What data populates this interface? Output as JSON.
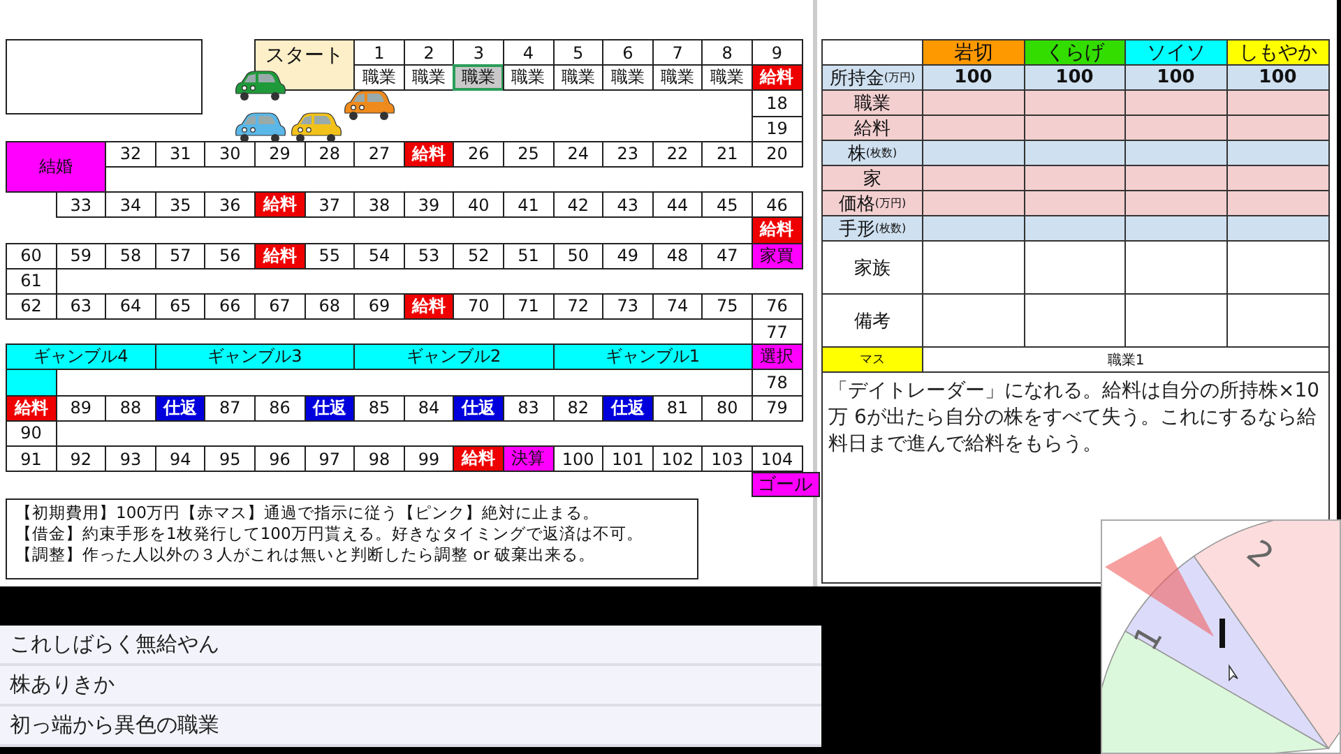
{
  "board": {
    "track": [
      {
        "squares": [
          {
            "label": "スタート",
            "kind": "start",
            "selected": false
          },
          {
            "label": "1",
            "kind": "number",
            "selected": false
          },
          {
            "label": "2",
            "kind": "number",
            "selected": false
          },
          {
            "label": "3",
            "kind": "number",
            "selected": false
          },
          {
            "label": "4",
            "kind": "number",
            "selected": false
          },
          {
            "label": "5",
            "kind": "number",
            "selected": false
          },
          {
            "label": "6",
            "kind": "number",
            "selected": false
          },
          {
            "label": "7",
            "kind": "number",
            "selected": false
          },
          {
            "label": "8",
            "kind": "number",
            "selected": false
          },
          {
            "label": "9",
            "kind": "number",
            "selected": false
          }
        ]
      },
      {
        "squares": [
          {
            "label": "職業",
            "kind": "job",
            "selected": false
          },
          {
            "label": "職業",
            "kind": "job",
            "selected": false
          },
          {
            "label": "職業",
            "kind": "job",
            "selected": true
          },
          {
            "label": "職業",
            "kind": "job",
            "selected": false
          },
          {
            "label": "職業",
            "kind": "job",
            "selected": false
          },
          {
            "label": "職業",
            "kind": "job",
            "selected": false
          },
          {
            "label": "職業",
            "kind": "job",
            "selected": false
          },
          {
            "label": "職業",
            "kind": "job",
            "selected": false
          },
          {
            "label": "給料",
            "kind": "salary",
            "selected": false
          }
        ]
      },
      {
        "squares": [
          {
            "label": "18",
            "kind": "number",
            "selected": false
          }
        ]
      },
      {
        "squares": [
          {
            "label": "19",
            "kind": "number",
            "selected": false
          }
        ]
      },
      {
        "squares": [
          {
            "label": "結婚",
            "kind": "event",
            "selected": false
          },
          {
            "label": "32",
            "kind": "number",
            "selected": false
          },
          {
            "label": "31",
            "kind": "number",
            "selected": false
          },
          {
            "label": "30",
            "kind": "number",
            "selected": false
          },
          {
            "label": "29",
            "kind": "number",
            "selected": false
          },
          {
            "label": "28",
            "kind": "number",
            "selected": false
          },
          {
            "label": "27",
            "kind": "number",
            "selected": false
          },
          {
            "label": "給料",
            "kind": "salary",
            "selected": false
          },
          {
            "label": "26",
            "kind": "number",
            "selected": false
          },
          {
            "label": "25",
            "kind": "number",
            "selected": false
          },
          {
            "label": "24",
            "kind": "number",
            "selected": false
          },
          {
            "label": "23",
            "kind": "number",
            "selected": false
          },
          {
            "label": "22",
            "kind": "number",
            "selected": false
          },
          {
            "label": "21",
            "kind": "number",
            "selected": false
          },
          {
            "label": "20",
            "kind": "number",
            "selected": false
          }
        ]
      },
      {
        "squares": [
          {
            "label": "33",
            "kind": "number",
            "selected": false
          },
          {
            "label": "34",
            "kind": "number",
            "selected": false
          },
          {
            "label": "35",
            "kind": "number",
            "selected": false
          },
          {
            "label": "36",
            "kind": "number",
            "selected": false
          },
          {
            "label": "給料",
            "kind": "salary",
            "selected": false
          },
          {
            "label": "37",
            "kind": "number",
            "selected": false
          },
          {
            "label": "38",
            "kind": "number",
            "selected": false
          },
          {
            "label": "39",
            "kind": "number",
            "selected": false
          },
          {
            "label": "40",
            "kind": "number",
            "selected": false
          },
          {
            "label": "41",
            "kind": "number",
            "selected": false
          },
          {
            "label": "42",
            "kind": "number",
            "selected": false
          },
          {
            "label": "43",
            "kind": "number",
            "selected": false
          },
          {
            "label": "44",
            "kind": "number",
            "selected": false
          },
          {
            "label": "45",
            "kind": "number",
            "selected": false
          },
          {
            "label": "46",
            "kind": "number",
            "selected": false
          }
        ]
      },
      {
        "squares": [
          {
            "label": "給料",
            "kind": "salary",
            "selected": false
          }
        ]
      },
      {
        "squares": [
          {
            "label": "60",
            "kind": "number",
            "selected": false
          },
          {
            "label": "59",
            "kind": "number",
            "selected": false
          },
          {
            "label": "58",
            "kind": "number",
            "selected": false
          },
          {
            "label": "57",
            "kind": "number",
            "selected": false
          },
          {
            "label": "56",
            "kind": "number",
            "selected": false
          },
          {
            "label": "給料",
            "kind": "salary",
            "selected": false
          },
          {
            "label": "55",
            "kind": "number",
            "selected": false
          },
          {
            "label": "54",
            "kind": "number",
            "selected": false
          },
          {
            "label": "53",
            "kind": "number",
            "selected": false
          },
          {
            "label": "52",
            "kind": "number",
            "selected": false
          },
          {
            "label": "51",
            "kind": "number",
            "selected": false
          },
          {
            "label": "50",
            "kind": "number",
            "selected": false
          },
          {
            "label": "49",
            "kind": "number",
            "selected": false
          },
          {
            "label": "48",
            "kind": "number",
            "selected": false
          },
          {
            "label": "47",
            "kind": "number",
            "selected": false
          },
          {
            "label": "家買",
            "kind": "event",
            "selected": false
          }
        ]
      },
      {
        "squares": [
          {
            "label": "61",
            "kind": "number",
            "selected": false
          }
        ]
      },
      {
        "squares": [
          {
            "label": "62",
            "kind": "number",
            "selected": false
          },
          {
            "label": "63",
            "kind": "number",
            "selected": false
          },
          {
            "label": "64",
            "kind": "number",
            "selected": false
          },
          {
            "label": "65",
            "kind": "number",
            "selected": false
          },
          {
            "label": "66",
            "kind": "number",
            "selected": false
          },
          {
            "label": "67",
            "kind": "number",
            "selected": false
          },
          {
            "label": "68",
            "kind": "number",
            "selected": false
          },
          {
            "label": "69",
            "kind": "number",
            "selected": false
          },
          {
            "label": "給料",
            "kind": "salary",
            "selected": false
          },
          {
            "label": "70",
            "kind": "number",
            "selected": false
          },
          {
            "label": "71",
            "kind": "number",
            "selected": false
          },
          {
            "label": "72",
            "kind": "number",
            "selected": false
          },
          {
            "label": "73",
            "kind": "number",
            "selected": false
          },
          {
            "label": "74",
            "kind": "number",
            "selected": false
          },
          {
            "label": "75",
            "kind": "number",
            "selected": false
          },
          {
            "label": "76",
            "kind": "number",
            "selected": false
          }
        ]
      },
      {
        "squares": [
          {
            "label": "77",
            "kind": "number",
            "selected": false
          }
        ]
      },
      {
        "squares": [
          {
            "label": "ギャンブル4",
            "kind": "gamble",
            "selected": false
          },
          {
            "label": "ギャンブル3",
            "kind": "gamble",
            "selected": false
          },
          {
            "label": "ギャンブル2",
            "kind": "gamble",
            "selected": false
          },
          {
            "label": "ギャンブル1",
            "kind": "gamble",
            "selected": false
          },
          {
            "label": "選択",
            "kind": "event",
            "selected": false
          }
        ]
      },
      {
        "squares": [
          {
            "kind": "gamble",
            "selected": false
          },
          {
            "label": "78",
            "kind": "number",
            "selected": false
          }
        ]
      },
      {
        "squares": [
          {
            "label": "給料",
            "kind": "salary",
            "selected": false
          },
          {
            "label": "89",
            "kind": "number",
            "selected": false
          },
          {
            "label": "88",
            "kind": "number",
            "selected": false
          },
          {
            "label": "仕返",
            "kind": "revenge",
            "selected": false
          },
          {
            "label": "87",
            "kind": "number",
            "selected": false
          },
          {
            "label": "86",
            "kind": "number",
            "selected": false
          },
          {
            "label": "仕返",
            "kind": "revenge",
            "selected": false
          },
          {
            "label": "85",
            "kind": "number",
            "selected": false
          },
          {
            "label": "84",
            "kind": "number",
            "selected": false
          },
          {
            "label": "仕返",
            "kind": "revenge",
            "selected": false
          },
          {
            "label": "83",
            "kind": "number",
            "selected": false
          },
          {
            "label": "82",
            "kind": "number",
            "selected": false
          },
          {
            "label": "仕返",
            "kind": "revenge",
            "selected": false
          },
          {
            "label": "81",
            "kind": "number",
            "selected": false
          },
          {
            "label": "80",
            "kind": "number",
            "selected": false
          },
          {
            "label": "79",
            "kind": "number",
            "selected": false
          }
        ]
      },
      {
        "squares": [
          {
            "label": "90",
            "kind": "number",
            "selected": false
          }
        ]
      },
      {
        "squares": [
          {
            "label": "91",
            "kind": "number",
            "selected": false
          },
          {
            "label": "92",
            "kind": "number",
            "selected": false
          },
          {
            "label": "93",
            "kind": "number",
            "selected": false
          },
          {
            "label": "94",
            "kind": "number",
            "selected": false
          },
          {
            "label": "95",
            "kind": "number",
            "selected": false
          },
          {
            "label": "96",
            "kind": "number",
            "selected": false
          },
          {
            "label": "97",
            "kind": "number",
            "selected": false
          },
          {
            "label": "98",
            "kind": "number",
            "selected": false
          },
          {
            "label": "99",
            "kind": "number",
            "selected": false
          },
          {
            "label": "給料",
            "kind": "salary",
            "selected": false
          },
          {
            "label": "決算",
            "kind": "event",
            "selected": false
          },
          {
            "label": "100",
            "kind": "number",
            "selected": false
          },
          {
            "label": "101",
            "kind": "number",
            "selected": false
          },
          {
            "label": "102",
            "kind": "number",
            "selected": false
          },
          {
            "label": "103",
            "kind": "number",
            "selected": false
          },
          {
            "label": "104",
            "kind": "number",
            "selected": false
          }
        ]
      },
      {
        "squares": [
          {
            "label": "ゴール",
            "kind": "goal",
            "selected": false
          }
        ]
      }
    ],
    "tokens": [
      {
        "color": "#1f9a3a"
      },
      {
        "color": "#ef8a1c"
      },
      {
        "color": "#5ab7e8"
      },
      {
        "color": "#f2c21b"
      }
    ],
    "rules": [
      "【初期費用】100万円【赤マス】通過で指示に従う【ピンク】絶対に止まる。",
      "【借金】約束手形を1枚発行して100万円貰える。好きなタイミングで返済は不可。",
      "【調整】作った人以外の３人がこれは無いと判断したら調整 or 破棄出来る。"
    ]
  },
  "status_table": {
    "players": [
      {
        "name": "岩切",
        "color": "#ff9900"
      },
      {
        "name": "くらげ",
        "color": "#33dd00"
      },
      {
        "name": "ソイソ",
        "color": "#00ffff"
      },
      {
        "name": "しもやか",
        "color": "#ffff00"
      }
    ],
    "rows": [
      {
        "label": "所持金",
        "unit": "(万円)",
        "kind": "asset",
        "values": [
          "100",
          "100",
          "100",
          "100"
        ]
      },
      {
        "label": "職業",
        "kind": "life"
      },
      {
        "label": "給料",
        "kind": "life"
      },
      {
        "label": "株",
        "unit": "(枚数)",
        "kind": "asset"
      },
      {
        "label": "家",
        "kind": "life"
      },
      {
        "label": "価格",
        "unit": "(万円)",
        "kind": "life"
      },
      {
        "label": "手形",
        "unit": "(枚数)",
        "kind": "asset"
      },
      {
        "label": "家族",
        "kind": "note"
      },
      {
        "label": "備考",
        "kind": "note"
      }
    ],
    "square": {
      "label": "マス",
      "name": "職業1",
      "description": "「デイトレーダー」になれる。給料は自分の所持株×10万 6が出たら自分の株をすべて失う。これにするなら給料日まで進んで給料をもらう。"
    }
  },
  "comments": [
    "これしばらく無給やん",
    "株ありきか",
    "初っ端から異色の職業"
  ],
  "roulette": {
    "segments": [
      {
        "label": "2",
        "color": "#fcdcdc"
      },
      {
        "label": "1",
        "color": "#dcdcfa"
      },
      {
        "color": "#dcf8dc"
      }
    ]
  }
}
